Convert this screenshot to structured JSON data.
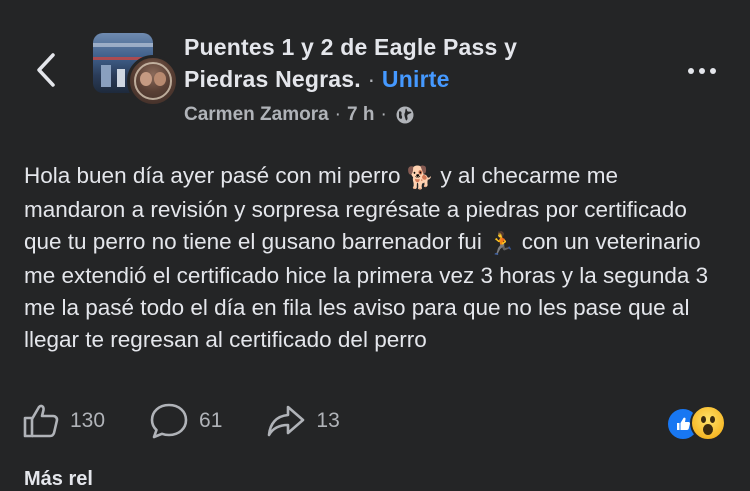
{
  "header": {
    "group_name": "Puentes 1 y 2 de Eagle Pass y Piedras Negras.",
    "separator": "·",
    "join_label": "Unirte",
    "author": "Carmen Zamora",
    "meta_separator": "·",
    "time": "7 h",
    "privacy_icon": "globe-icon",
    "back_icon": "chevron-left-icon",
    "more_icon": "more-horizontal-icon"
  },
  "post": {
    "segment_1": "Hola buen día ayer pasé con mi perro ",
    "emoji_1": "🐕",
    "segment_2": " y al checarme me mandaron a revisión y sorpresa regrésate a piedras por certificado que tu perro no tiene el gusano barrenador fui ",
    "emoji_2": "🏃",
    "segment_3": " con un veterinario me extendió el certificado hice la primera vez 3 horas y la segunda 3 me la pasé todo el día en fila les aviso para que no les pase que al llegar te regresan al certificado del perro"
  },
  "actions": {
    "likes": "130",
    "comments": "61",
    "shares": "13",
    "like_icon": "thumbs-up-icon",
    "comment_icon": "comment-icon",
    "share_icon": "share-icon",
    "reactions": [
      "like",
      "wow"
    ]
  },
  "footer": {
    "next_section_label": "Más rel"
  },
  "colors": {
    "background": "#242526",
    "text": "#e4e6eb",
    "muted": "#b0b3b8",
    "link": "#4599ff",
    "like_blue": "#1877f2",
    "wow_yellow": "#f7b928"
  }
}
